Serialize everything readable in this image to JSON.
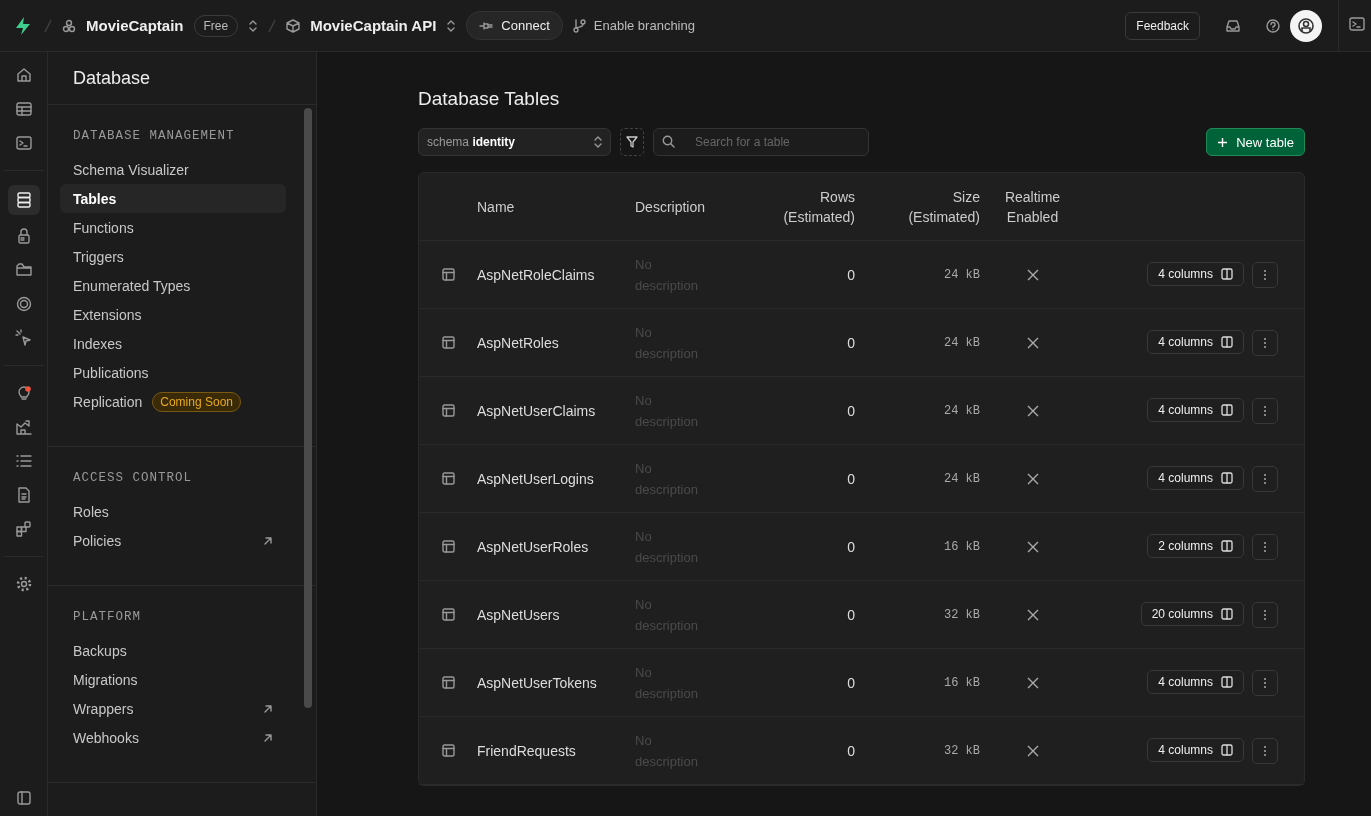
{
  "topbar": {
    "org": "MovieCaptain",
    "plan": "Free",
    "project": "MovieCaptain API",
    "connect": "Connect",
    "branching": "Enable branching",
    "feedback": "Feedback"
  },
  "rail": [
    {
      "kind": "button",
      "selected": false
    },
    {
      "kind": "button",
      "selected": false
    },
    {
      "kind": "button",
      "selected": false
    },
    {
      "kind": "divider"
    },
    {
      "kind": "button",
      "selected": true
    },
    {
      "kind": "button",
      "selected": false
    },
    {
      "kind": "button",
      "selected": false
    },
    {
      "kind": "button",
      "selected": false
    },
    {
      "kind": "button",
      "selected": false
    },
    {
      "kind": "divider"
    },
    {
      "kind": "button",
      "selected": false
    },
    {
      "kind": "button",
      "selected": false
    },
    {
      "kind": "button",
      "selected": false
    },
    {
      "kind": "button",
      "selected": false
    },
    {
      "kind": "button",
      "selected": false
    },
    {
      "kind": "divider"
    },
    {
      "kind": "button",
      "selected": false
    }
  ],
  "sidebar": {
    "title": "Database",
    "sections": [
      {
        "title": "DATABASE MANAGEMENT",
        "items": [
          {
            "label": "Schema Visualizer",
            "selected": false
          },
          {
            "label": "Tables",
            "selected": true
          },
          {
            "label": "Functions",
            "selected": false
          },
          {
            "label": "Triggers",
            "selected": false
          },
          {
            "label": "Enumerated Types",
            "selected": false
          },
          {
            "label": "Extensions",
            "selected": false
          },
          {
            "label": "Indexes",
            "selected": false
          },
          {
            "label": "Publications",
            "selected": false
          },
          {
            "label": "Replication",
            "selected": false,
            "badge": "Coming Soon"
          }
        ]
      },
      {
        "title": "ACCESS CONTROL",
        "items": [
          {
            "label": "Roles",
            "selected": false
          },
          {
            "label": "Policies",
            "selected": false,
            "external": true
          }
        ]
      },
      {
        "title": "PLATFORM",
        "items": [
          {
            "label": "Backups",
            "selected": false
          },
          {
            "label": "Migrations",
            "selected": false
          },
          {
            "label": "Wrappers",
            "selected": false,
            "external": true
          },
          {
            "label": "Webhooks",
            "selected": false,
            "external": true
          }
        ]
      }
    ]
  },
  "main": {
    "title": "Database Tables",
    "schema_label": "schema",
    "schema": "identity",
    "search_placeholder": "Search for a table",
    "new_button": "New table",
    "columns": [
      "Name",
      "Description",
      "Rows\n(Estimated)",
      "Size\n(Estimated)",
      "Realtime\nEnabled"
    ],
    "rows": [
      {
        "name": "AspNetRoleClaims",
        "description": "No\ndescription",
        "rows": "0",
        "size": "24 kB",
        "realtime": false,
        "columns": "4 columns"
      },
      {
        "name": "AspNetRoles",
        "description": "No\ndescription",
        "rows": "0",
        "size": "24 kB",
        "realtime": false,
        "columns": "4 columns"
      },
      {
        "name": "AspNetUserClaims",
        "description": "No\ndescription",
        "rows": "0",
        "size": "24 kB",
        "realtime": false,
        "columns": "4 columns"
      },
      {
        "name": "AspNetUserLogins",
        "description": "No\ndescription",
        "rows": "0",
        "size": "24 kB",
        "realtime": false,
        "columns": "4 columns"
      },
      {
        "name": "AspNetUserRoles",
        "description": "No\ndescription",
        "rows": "0",
        "size": "16 kB",
        "realtime": false,
        "columns": "2 columns"
      },
      {
        "name": "AspNetUsers",
        "description": "No\ndescription",
        "rows": "0",
        "size": "32 kB",
        "realtime": false,
        "columns": "20 columns"
      },
      {
        "name": "AspNetUserTokens",
        "description": "No\ndescription",
        "rows": "0",
        "size": "16 kB",
        "realtime": false,
        "columns": "4 columns"
      },
      {
        "name": "FriendRequests",
        "description": "No\ndescription",
        "rows": "0",
        "size": "32 kB",
        "realtime": false,
        "columns": "4 columns"
      }
    ]
  }
}
